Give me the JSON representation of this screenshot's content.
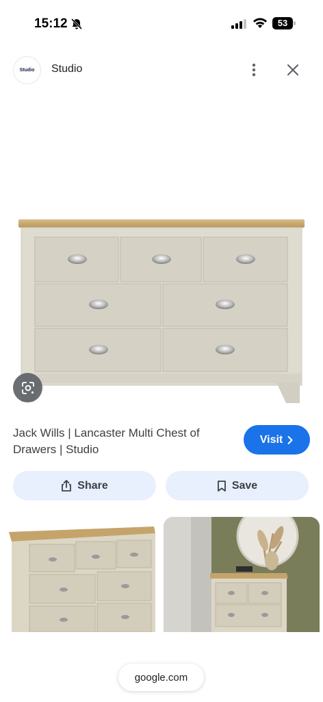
{
  "status_bar": {
    "time": "15:12",
    "battery_level": "53"
  },
  "header": {
    "source_logo_text": "Studio",
    "source_name": "Studio"
  },
  "result": {
    "title": "Jack Wills | Lancaster Multi Chest of Drawers | Studio",
    "visit_label": "Visit",
    "share_label": "Share",
    "save_label": "Save"
  },
  "footer": {
    "domain": "google.com"
  },
  "icons": [
    "bell-slash-icon",
    "signal-icon",
    "wifi-icon",
    "battery-icon",
    "more-vertical-icon",
    "close-icon",
    "lens-icon",
    "chevron-right-icon",
    "share-icon",
    "bookmark-icon"
  ],
  "colors": {
    "accent": "#1a73e8",
    "action_bg": "#e8effd",
    "cabinet_body": "#d9d5c8",
    "cabinet_top": "#c9ab76"
  }
}
